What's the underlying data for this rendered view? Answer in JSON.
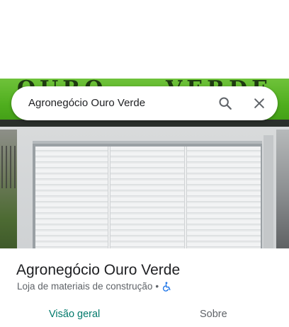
{
  "search": {
    "value": "Agronegócio Ouro Verde",
    "search_icon": "search-icon",
    "close_icon": "close-icon"
  },
  "hero": {
    "sign_words": [
      "OURO",
      "VERDE"
    ]
  },
  "place": {
    "name": "Agronegócio Ouro Verde",
    "category": "Loja de materiais de construção",
    "separator": "•",
    "accessibility_icon": "wheelchair-icon"
  },
  "tabs": [
    {
      "label": "Visão geral",
      "active": true
    },
    {
      "label": "Sobre",
      "active": false
    }
  ],
  "colors": {
    "active_tab": "#00796b",
    "accessibility": "#1a73e8",
    "sign_green": "#4fae1e"
  }
}
